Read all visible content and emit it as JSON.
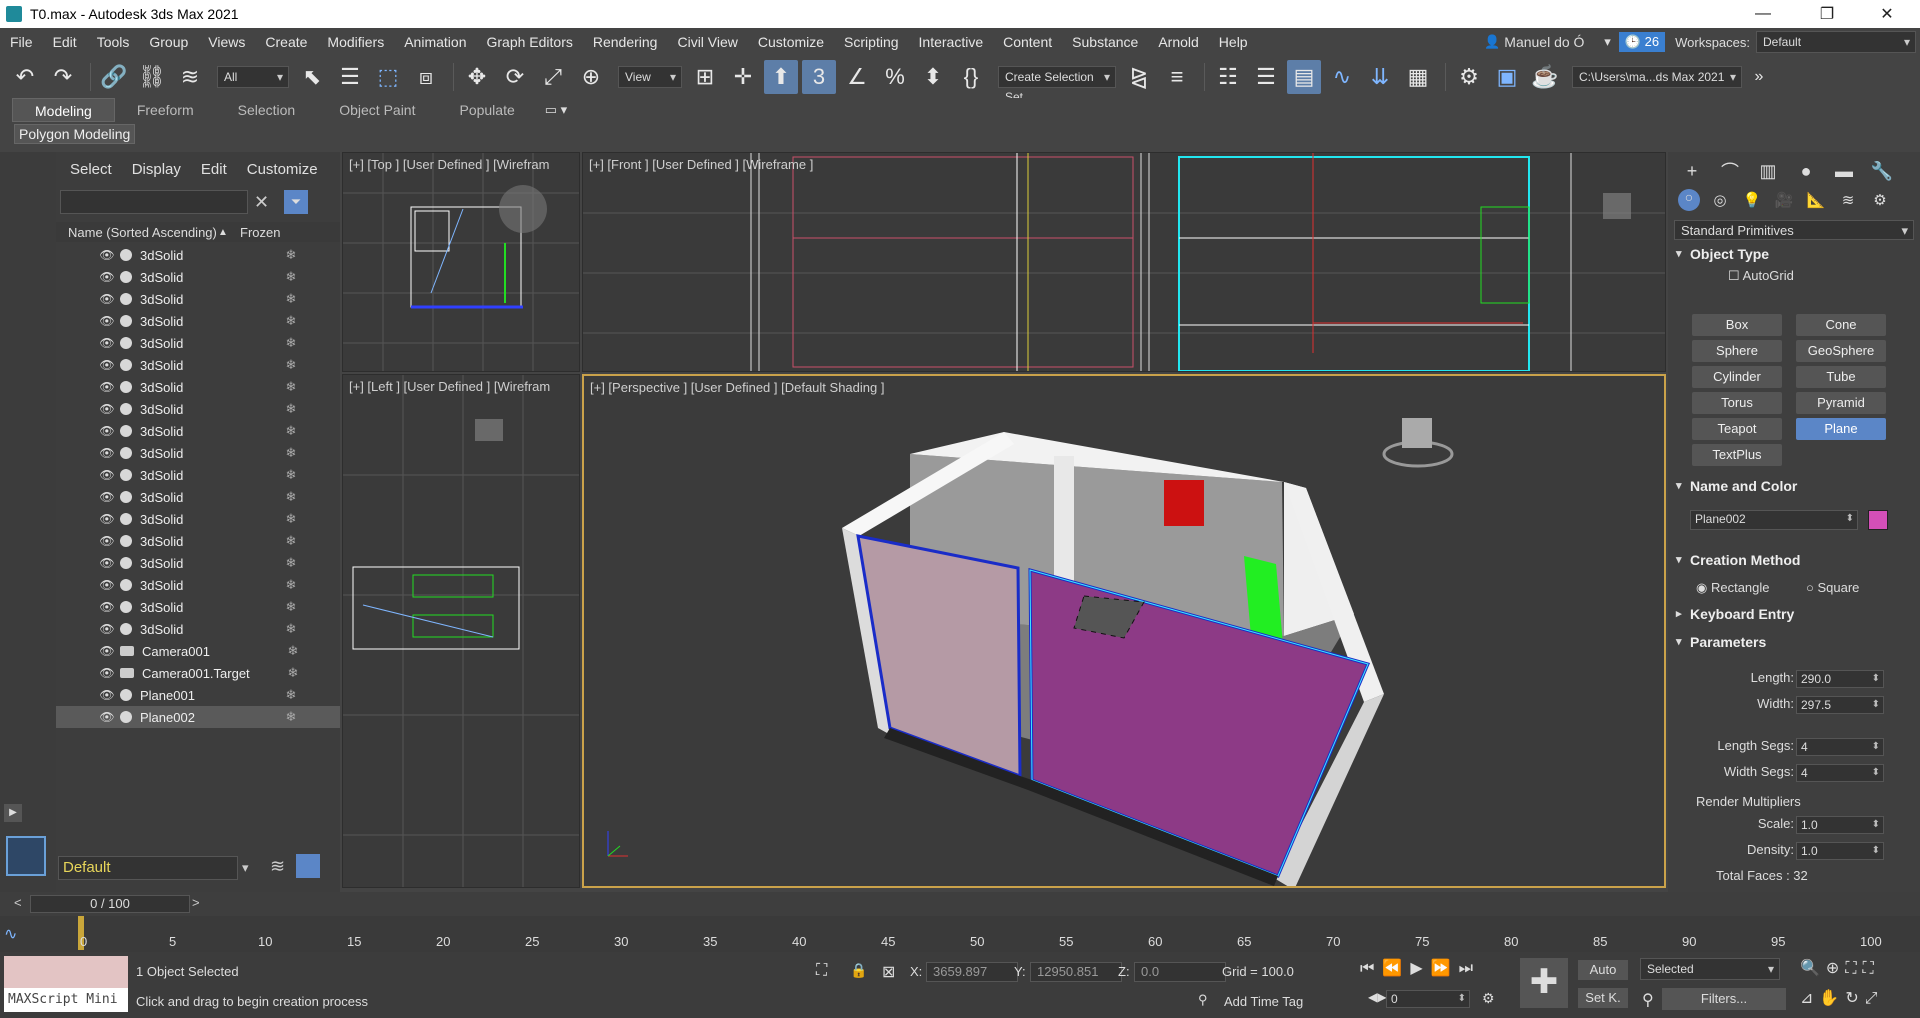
{
  "window": {
    "title": "T0.max - Autodesk 3ds Max 2021"
  },
  "menu": [
    "File",
    "Edit",
    "Tools",
    "Group",
    "Views",
    "Create",
    "Modifiers",
    "Animation",
    "Graph Editors",
    "Rendering",
    "Civil View",
    "Customize",
    "Scripting",
    "Interactive",
    "Content",
    "Substance",
    "Arnold",
    "Help"
  ],
  "user": {
    "name": "Manuel do Ó",
    "badge": "26",
    "workspaces_label": "Workspaces:",
    "workspace": "Default"
  },
  "toolbar": {
    "filter": "All",
    "ref_coord": "View",
    "selection_set": "Create Selection Set",
    "path": "C:\\Users\\ma...ds Max 2021"
  },
  "ribbon": {
    "tabs": [
      "Modeling",
      "Freeform",
      "Selection",
      "Object Paint",
      "Populate"
    ],
    "sub": "Polygon Modeling"
  },
  "explorer": {
    "tabs": [
      "Select",
      "Display",
      "Edit",
      "Customize"
    ],
    "col_name": "Name (Sorted Ascending)",
    "col_frozen": "Frozen",
    "rows": [
      "3dSolid",
      "3dSolid",
      "3dSolid",
      "3dSolid",
      "3dSolid",
      "3dSolid",
      "3dSolid",
      "3dSolid",
      "3dSolid",
      "3dSolid",
      "3dSolid",
      "3dSolid",
      "3dSolid",
      "3dSolid",
      "3dSolid",
      "3dSolid",
      "3dSolid",
      "3dSolid",
      "Camera001",
      "Camera001.Target",
      "Plane001",
      "Plane002"
    ],
    "layer": "Default"
  },
  "viewports": {
    "top": "[+] [Top ] [User Defined ] [Wirefram",
    "front": "[+] [Front ] [User Defined ] [Wireframe ]",
    "left": "[+] [Left ] [User Defined ] [Wirefram",
    "persp": "[+] [Perspective ] [User Defined ] [Default Shading ]"
  },
  "command": {
    "category": "Standard Primitives",
    "object_type": "Object Type",
    "autogrid": "AutoGrid",
    "buttons": [
      "Box",
      "Cone",
      "Sphere",
      "GeoSphere",
      "Cylinder",
      "Tube",
      "Torus",
      "Pyramid",
      "Teapot",
      "Plane",
      "TextPlus"
    ],
    "name_color": "Name and Color",
    "object_name": "Plane002",
    "object_color": "#d44fb8",
    "creation_method": "Creation Method",
    "rectangle": "Rectangle",
    "square": "Square",
    "keyboard_entry": "Keyboard Entry",
    "parameters": "Parameters",
    "length_label": "Length:",
    "length": "290.0",
    "width_label": "Width:",
    "width": "297.5",
    "lsegs_label": "Length Segs:",
    "lsegs": "4",
    "wsegs_label": "Width Segs:",
    "wsegs": "4",
    "render_mult": "Render Multipliers",
    "scale_label": "Scale:",
    "scale": "1.0",
    "density_label": "Density:",
    "density": "1.0",
    "total_faces": "Total Faces : 32"
  },
  "timeline": {
    "frame": "0 / 100",
    "ticks": [
      "0",
      "5",
      "10",
      "15",
      "20",
      "25",
      "30",
      "35",
      "40",
      "45",
      "50",
      "55",
      "60",
      "65",
      "70",
      "75",
      "80",
      "85",
      "90",
      "95",
      "100"
    ]
  },
  "status": {
    "maxscript": "MAXScript Mini",
    "selected": "1 Object Selected",
    "prompt": "Click and drag to begin creation process",
    "x_label": "X:",
    "x": "3659.897",
    "y_label": "Y:",
    "y": "12950.851",
    "z_label": "Z:",
    "z": "0.0",
    "grid": "Grid = 100.0",
    "add_time_tag": "Add Time Tag",
    "auto": "Auto",
    "setk": "Set K.",
    "selected_dd": "Selected",
    "filters": "Filters...",
    "frame_field": "0"
  }
}
